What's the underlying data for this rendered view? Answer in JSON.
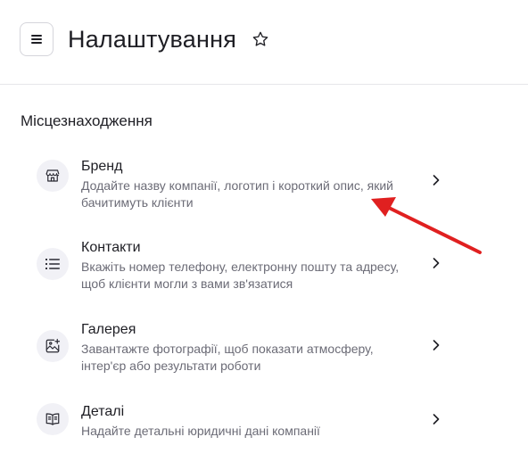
{
  "header": {
    "title": "Налаштування",
    "menu_icon": "menu-icon",
    "star_icon": "star-icon"
  },
  "section": {
    "title": "Місцезнаходження"
  },
  "items": [
    {
      "title": "Бренд",
      "description": "Додайте назву компанії, логотип і короткий опис, який бачитимуть клієнти",
      "icon": "storefront-icon"
    },
    {
      "title": "Контакти",
      "description": "Вкажіть номер телефону, електронну пошту та адресу, щоб клієнти могли з вами зв'язатися",
      "icon": "list-icon"
    },
    {
      "title": "Галерея",
      "description": "Завантажте фотографії, щоб показати атмосферу, інтер'єр або результати роботи",
      "icon": "gallery-icon"
    },
    {
      "title": "Деталі",
      "description": "Надайте детальні юридичні дані компанії",
      "icon": "book-icon"
    }
  ],
  "annotation": {
    "arrow_color": "#e02020"
  },
  "colors": {
    "text_primary": "#1e1e24",
    "text_secondary": "#6b6b76",
    "icon_bg": "#f1f1f6"
  }
}
